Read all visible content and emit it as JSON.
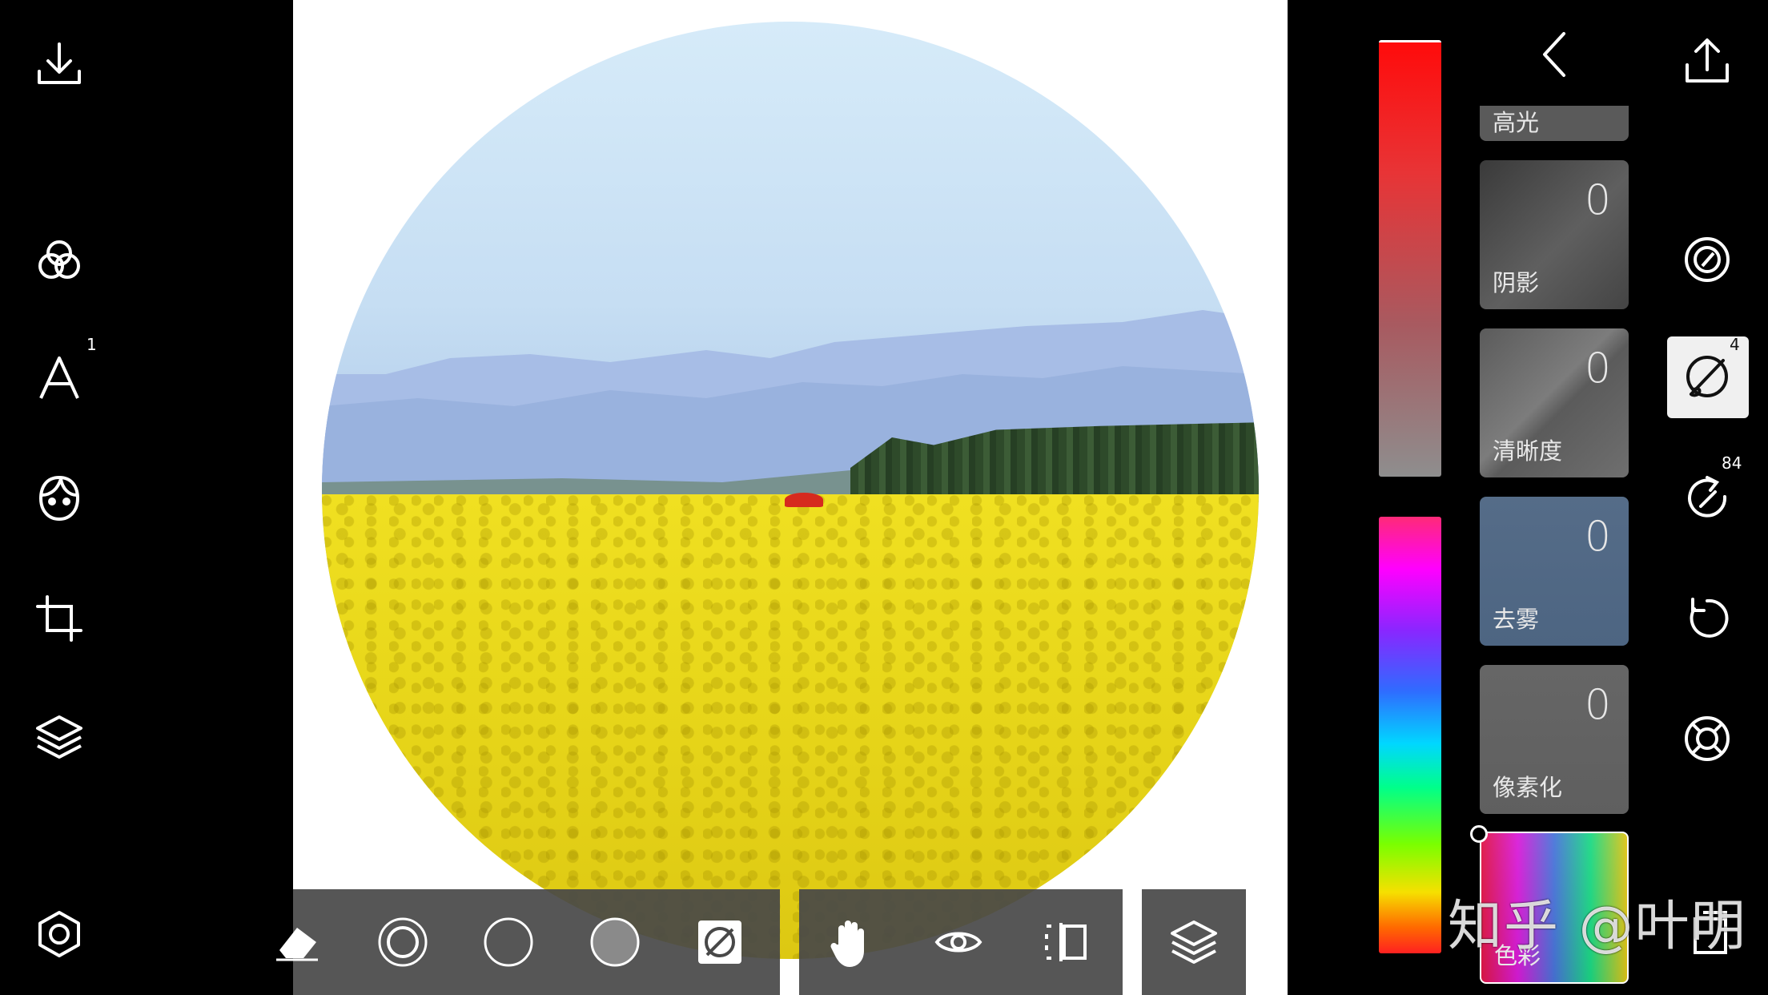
{
  "left_toolbar": {
    "text_badge": "1"
  },
  "right_panel": {
    "adjustments": [
      {
        "label": "高光",
        "value": ""
      },
      {
        "label": "阴影",
        "value": "0"
      },
      {
        "label": "清晰度",
        "value": "0"
      },
      {
        "label": "去雾",
        "value": "0"
      },
      {
        "label": "像素化",
        "value": "0"
      },
      {
        "label": "色彩",
        "value": ""
      }
    ]
  },
  "right_toolbar": {
    "brush_badge": "4",
    "redo_badge": "84"
  },
  "watermark": "知乎 @叶明",
  "colors": {
    "accent_red": "#ff0b0b",
    "panel_gray": "#484848"
  }
}
